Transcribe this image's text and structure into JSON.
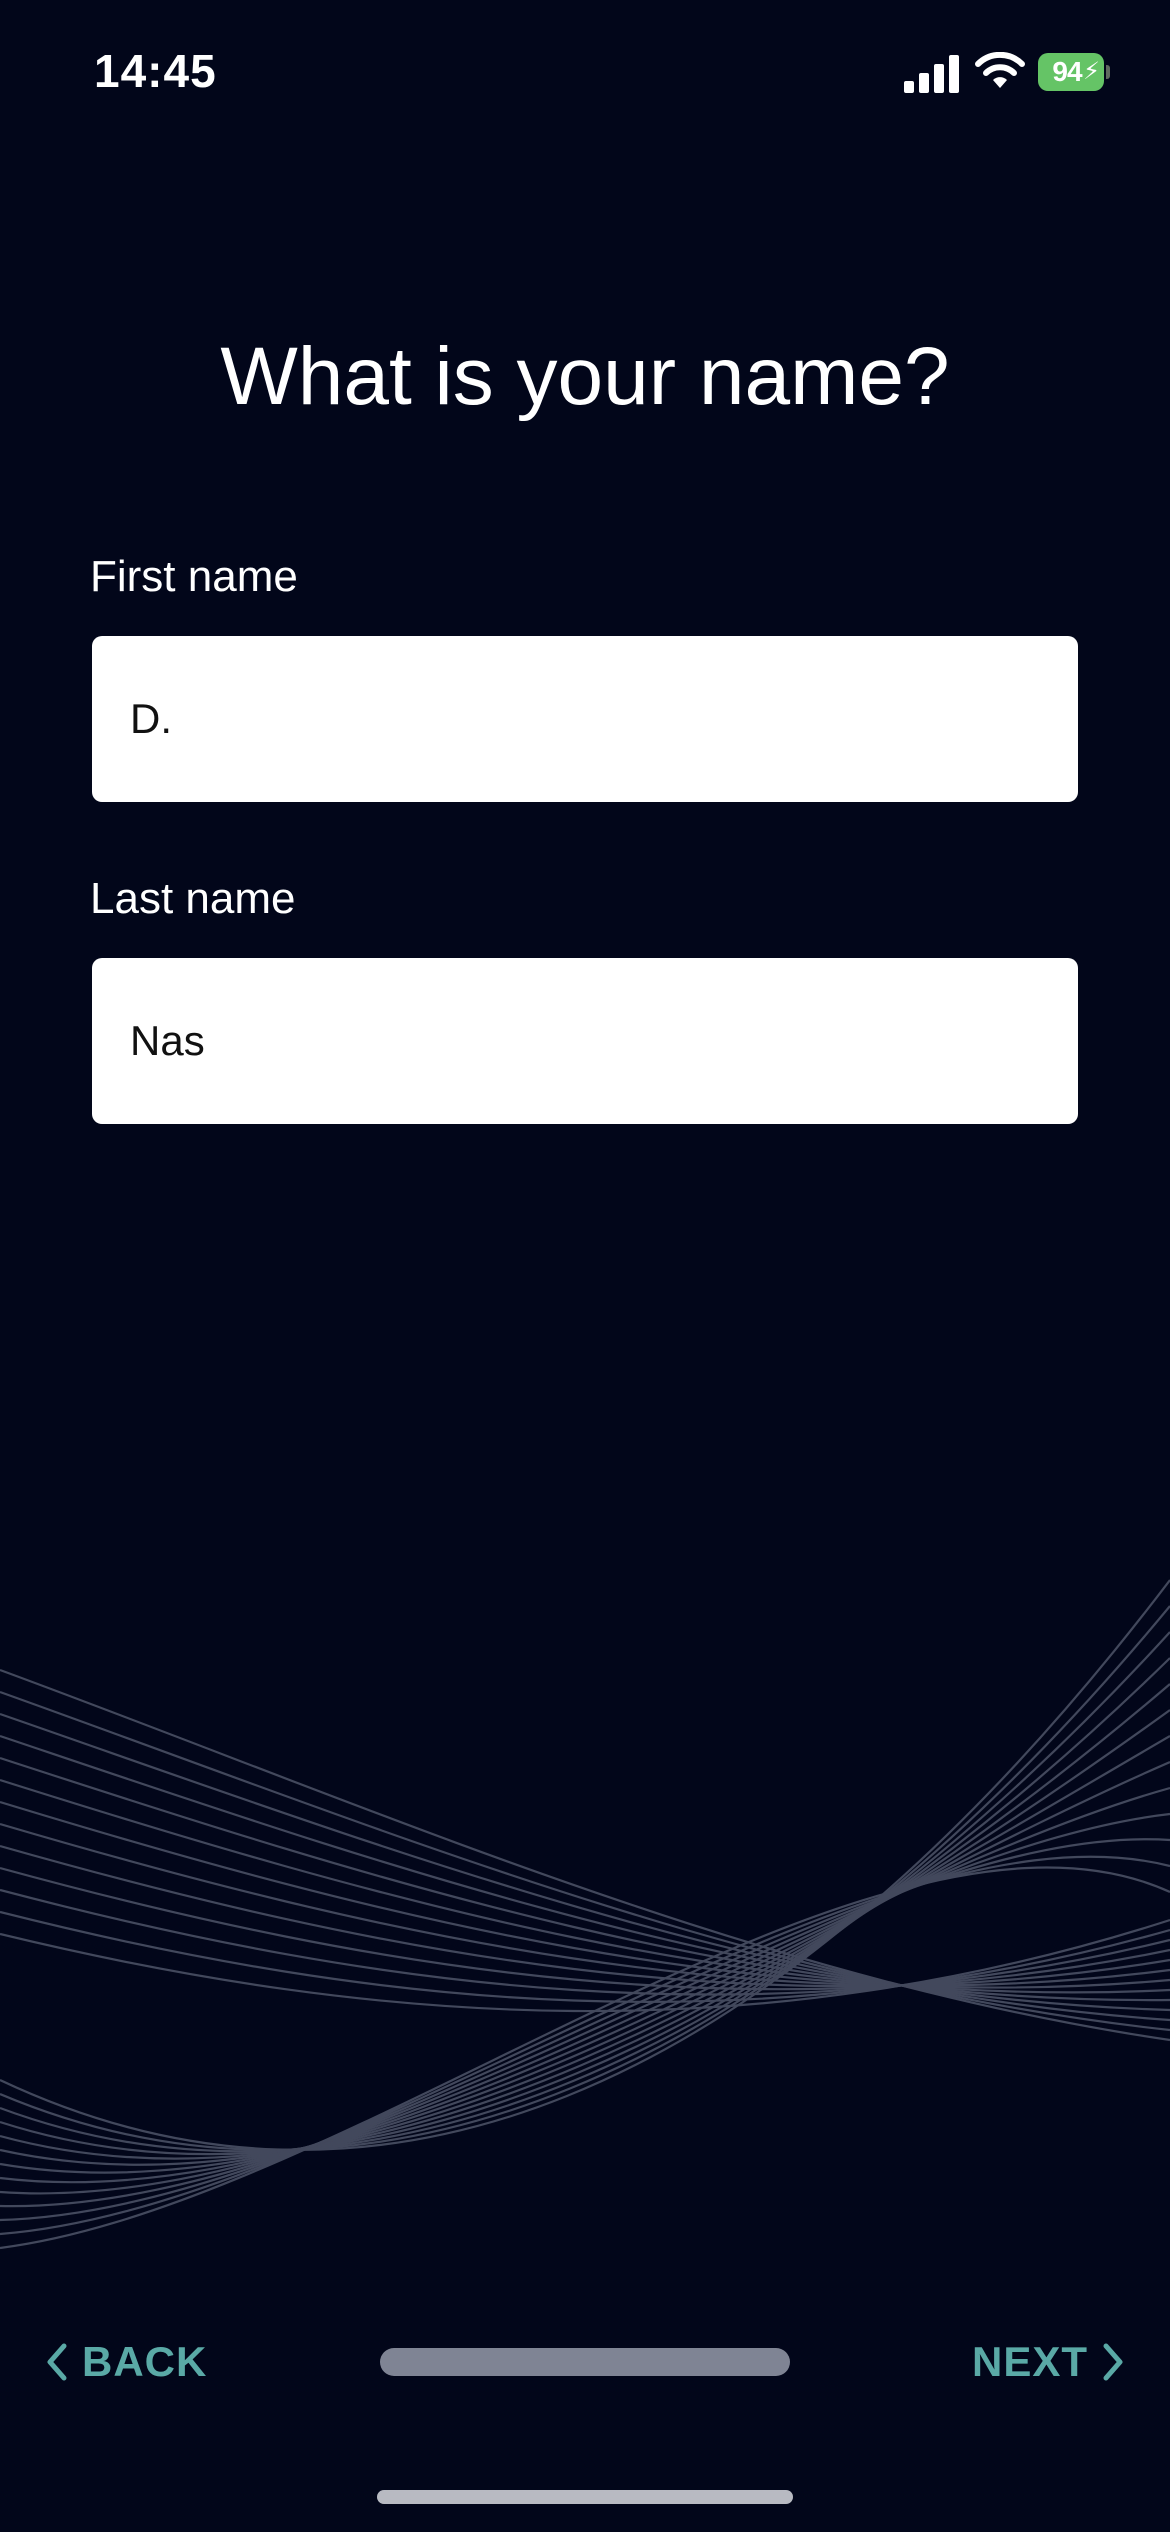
{
  "status_bar": {
    "time": "14:45",
    "battery_level": "94",
    "charging": true,
    "signal_bars": 4,
    "icons": [
      "signal-icon",
      "wifi-icon",
      "battery-icon",
      "bolt-icon"
    ]
  },
  "page": {
    "title": "What is your name?"
  },
  "form": {
    "first_name": {
      "label": "First name",
      "value": "D."
    },
    "last_name": {
      "label": "Last name",
      "value": "Nas"
    }
  },
  "navigation": {
    "back_label": "BACK",
    "next_label": "NEXT",
    "back_icon": "chevron-left-icon",
    "next_icon": "chevron-right-icon"
  },
  "colors": {
    "background": "#02061a",
    "accent": "#5aa9a6",
    "battery": "#65c466",
    "wave_lines": "#4a5064"
  }
}
